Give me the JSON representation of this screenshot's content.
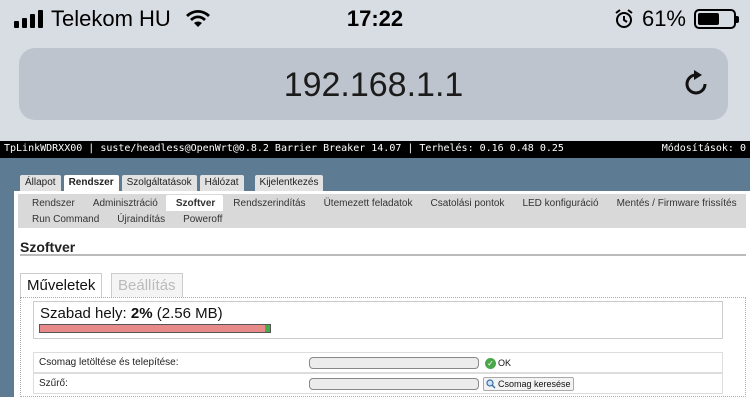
{
  "status_bar": {
    "carrier": "Telekom HU",
    "time": "17:22",
    "battery": "61%",
    "battery_level": 0.61
  },
  "browser": {
    "url": "192.168.1.1"
  },
  "router": {
    "info": "TpLinkWDRXX00 | suste/headless@OpenWrt@0.8.2 Barrier Breaker 14.07 | Terhelés: 0.16 0.48 0.25",
    "changes": "Módosítások: 0",
    "menu": [
      "Állapot",
      "Rendszer",
      "Szolgáltatások",
      "Hálózat",
      "Kijelentkezés"
    ],
    "submenu_row1": [
      "Rendszer",
      "Adminisztráció",
      "Szoftver",
      "Rendszerindítás",
      "Ütemezett feladatok",
      "Csatolási pontok",
      "LED konfiguráció",
      "Mentés / Firmware frissítés"
    ],
    "submenu_row2": [
      "Run Command",
      "Újraindítás",
      "Poweroff"
    ],
    "title": "Szoftver",
    "tabs": [
      "Műveletek",
      "Beállítás"
    ],
    "free_space": {
      "label": "Szabad hely:",
      "percent": "2%",
      "size": "(2.56 MB)",
      "free_fraction": 0.02
    },
    "install": {
      "label": "Csomag letöltése és telepítése:",
      "button": "OK",
      "value": ""
    },
    "filter": {
      "label": "Szűrő:",
      "button": "Csomag keresése",
      "value": ""
    }
  }
}
